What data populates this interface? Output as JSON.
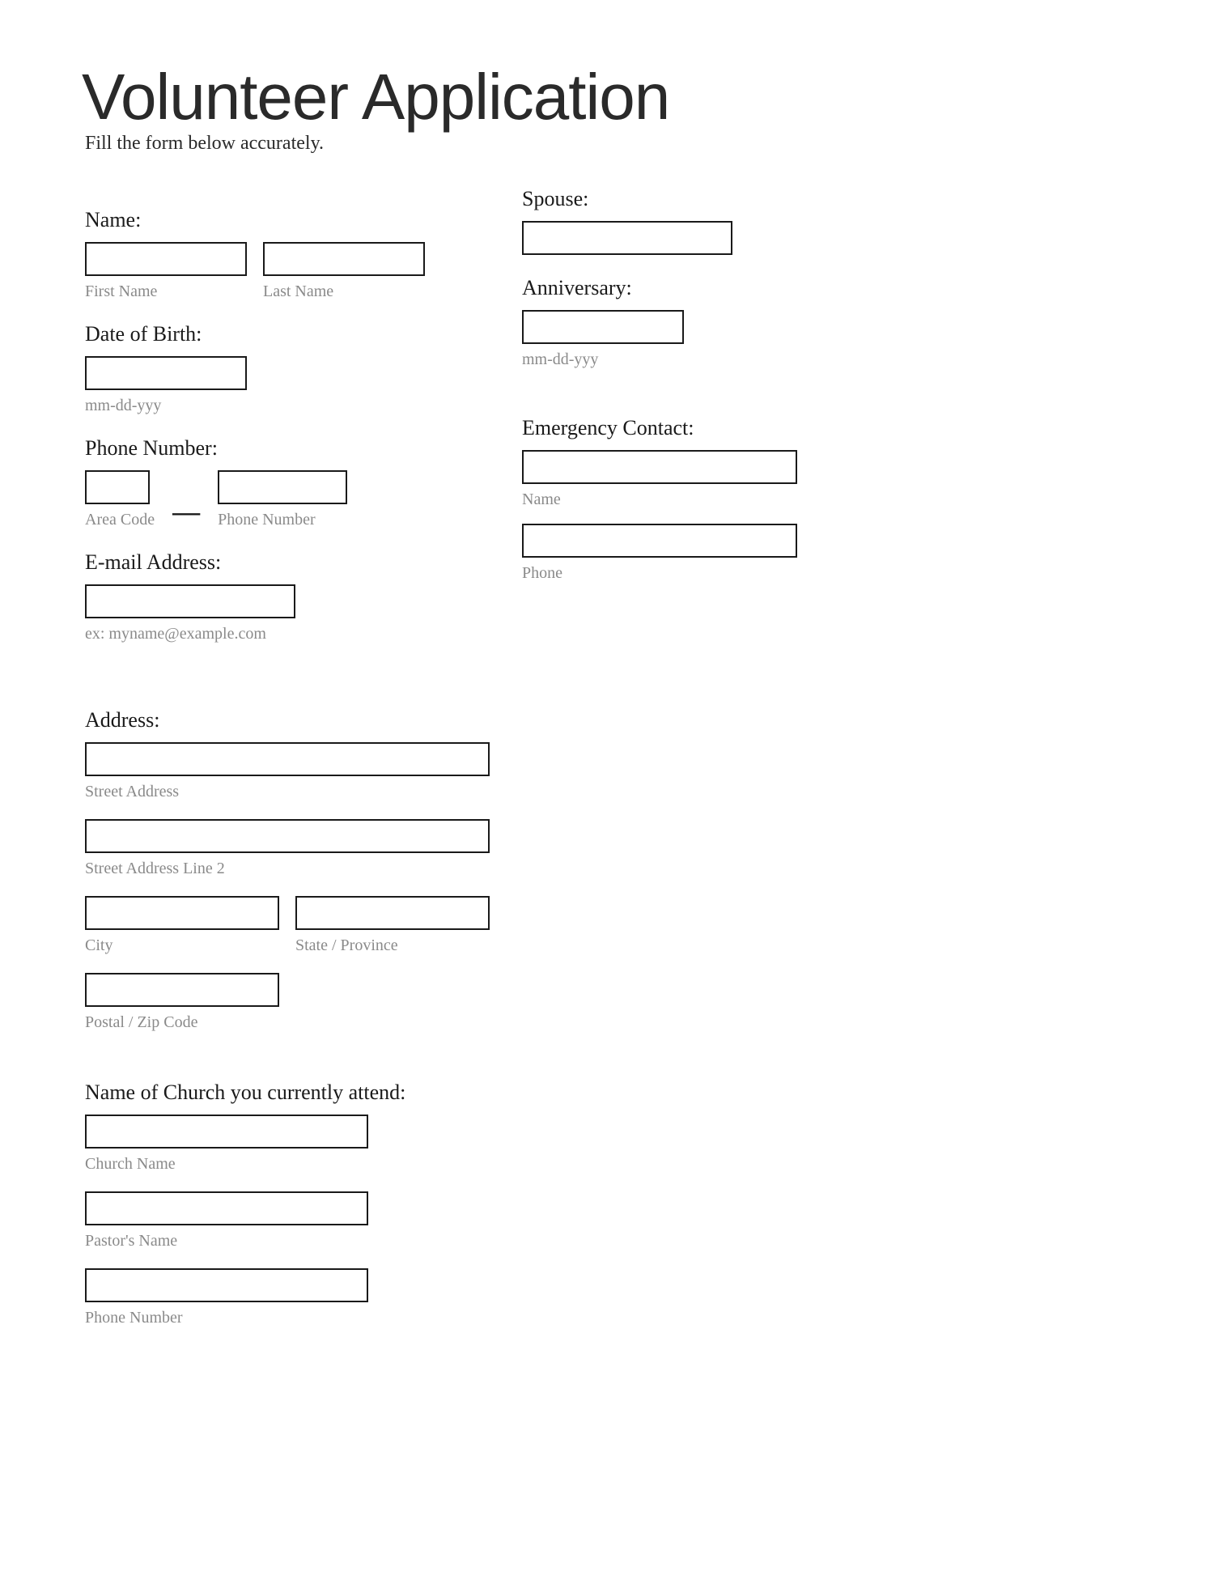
{
  "title": "Volunteer Application",
  "subtitle": "Fill the form below accurately.",
  "labels": {
    "name": "Name:",
    "first_name": "First Name",
    "last_name": "Last Name",
    "dob": "Date of Birth:",
    "dob_hint": "mm-dd-yyy",
    "phone": "Phone Number:",
    "area_code": "Area Code",
    "phone_num": "Phone Number",
    "dash": "—",
    "email": "E-mail Address:",
    "email_hint": "ex: myname@example.com",
    "spouse": "Spouse:",
    "anniversary": "Anniversary:",
    "anniversary_hint": "mm-dd-yyy",
    "emergency": "Emergency Contact:",
    "ec_name": "Name",
    "ec_phone": "Phone",
    "address": "Address:",
    "street1": "Street Address",
    "street2": "Street Address Line 2",
    "city": "City",
    "state": "State / Province",
    "zip": "Postal / Zip Code",
    "church": "Name of Church you currently attend:",
    "church_name": "Church Name",
    "pastor": "Pastor's Name",
    "church_phone": "Phone Number"
  }
}
